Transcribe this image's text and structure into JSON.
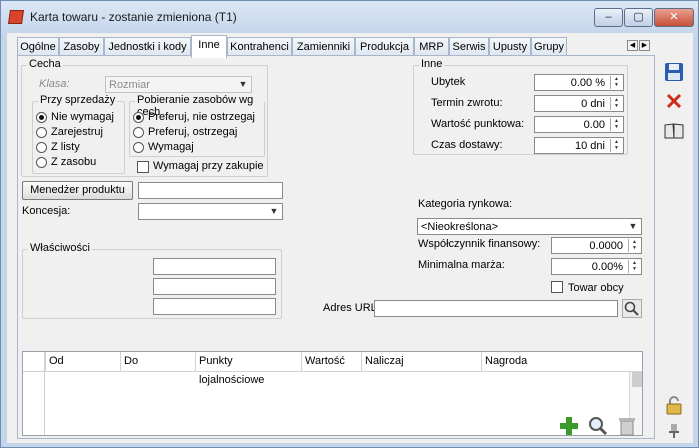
{
  "window": {
    "title": "Karta towaru - zostanie zmieniona (T1)",
    "min_label": "–",
    "max_label": "▢",
    "close_label": "✕"
  },
  "tabs": [
    {
      "label": "Ogólne"
    },
    {
      "label": "Zasoby"
    },
    {
      "label": "Jednostki i kody"
    },
    {
      "label": "Inne"
    },
    {
      "label": "Kontrahenci"
    },
    {
      "label": "Zamienniki"
    },
    {
      "label": "Produkcja"
    },
    {
      "label": "MRP"
    },
    {
      "label": "Serwis"
    },
    {
      "label": "Upusty"
    },
    {
      "label": "Grupy"
    }
  ],
  "active_tab": "Inne",
  "cecha": {
    "title": "Cecha",
    "klasa_label": "Klasa:",
    "klasa_value": "Rozmiar",
    "przy_sprzedazy": {
      "title": "Przy sprzedaży",
      "options": [
        "Nie wymagaj",
        "Zarejestruj",
        "Z listy",
        "Z zasobu"
      ],
      "selected": "Nie wymagaj"
    },
    "pobieranie": {
      "title": "Pobieranie zasobów wg cech",
      "options": [
        "Preferuj, nie ostrzegaj",
        "Preferuj, ostrzegaj",
        "Wymagaj"
      ],
      "selected": "Preferuj, nie ostrzegaj"
    },
    "wymagaj_przy_zakupie": "Wymagaj przy zakupie"
  },
  "inne": {
    "title": "Inne",
    "ubytek_label": "Ubytek",
    "ubytek_value": "0.00 %",
    "termin_label": "Termin zwrotu:",
    "termin_value": "0 dni",
    "wartosc_label": "Wartość punktowa:",
    "wartosc_value": "0.00",
    "czas_label": "Czas dostawy:",
    "czas_value": "10 dni"
  },
  "menedzer_button": "Menedżer produktu",
  "menedzer_value": "",
  "koncesja_label": "Koncesja:",
  "koncesja_value": "",
  "kategoria_label": "Kategoria rynkowa:",
  "kategoria_value": "<Nieokreślona>",
  "wspolczynnik_label": "Współczynnik finansowy:",
  "wspolczynnik_value": "0.0000",
  "marza_label": "Minimalna marża:",
  "marza_value": "0.00%",
  "towar_obcy_label": "Towar obcy",
  "wlasciwosci_title": "Właściwości",
  "adres_url_label": "Adres URL",
  "adres_url_value": "",
  "grid": {
    "columns": [
      "Od",
      "Do",
      "Punkty lojalnościowe",
      "Wartość",
      "Naliczaj",
      "Nagroda"
    ]
  },
  "icons": {
    "save": "save-icon",
    "delete": "delete-icon",
    "book": "book-icon",
    "add": "add-icon",
    "search": "search-icon",
    "trash": "trash-icon",
    "lock": "lock-icon",
    "pin": "pin-icon"
  },
  "colors": {
    "window_frame": "#c5d6eb",
    "accent_blue": "#2a5db0",
    "close_red": "#c6503a",
    "add_green": "#3a9a2a"
  }
}
